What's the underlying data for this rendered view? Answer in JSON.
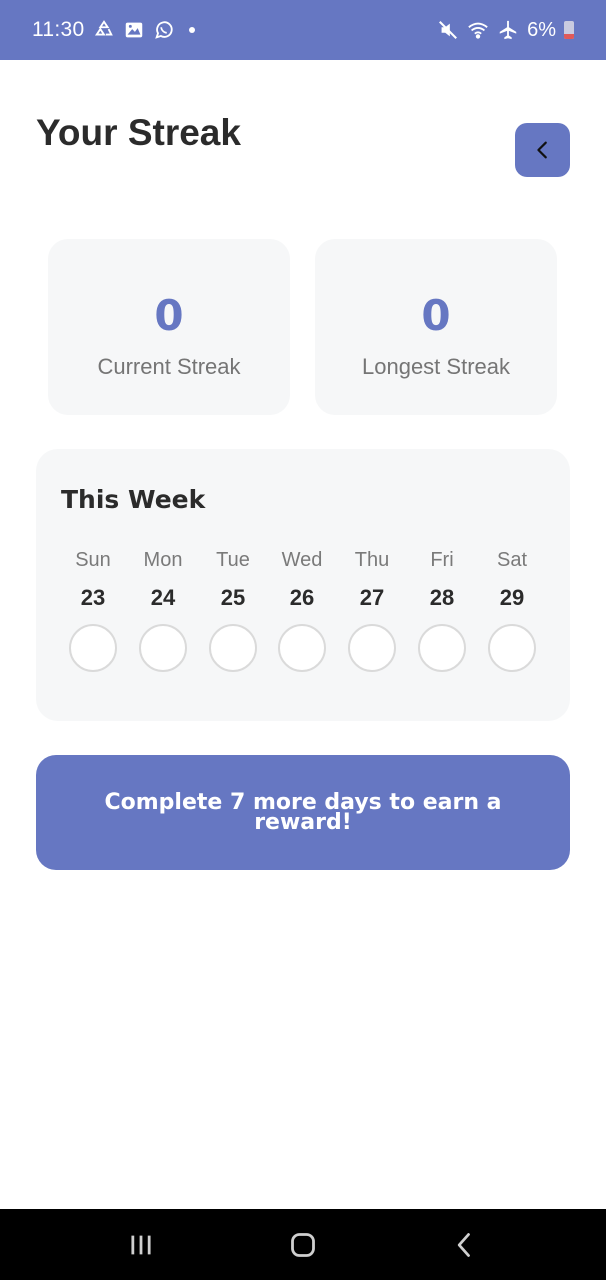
{
  "status_bar": {
    "time": "11:30",
    "battery_text": "6%",
    "battery_level": 0.06,
    "left_icons": [
      "recycle-icon",
      "gallery-icon",
      "whatsapp-icon"
    ],
    "right_icons": [
      "mute-icon",
      "wifi-icon",
      "airplane-icon",
      "battery-icon"
    ]
  },
  "header": {
    "title": "Your Streak",
    "back_icon": "chevron-left-icon"
  },
  "stats": {
    "current": {
      "value": "0",
      "label": "Current Streak"
    },
    "longest": {
      "value": "0",
      "label": "Longest Streak"
    }
  },
  "week": {
    "title": "This Week",
    "days": [
      {
        "name": "Sun",
        "date": "23",
        "completed": false
      },
      {
        "name": "Mon",
        "date": "24",
        "completed": false
      },
      {
        "name": "Tue",
        "date": "25",
        "completed": false
      },
      {
        "name": "Wed",
        "date": "26",
        "completed": false
      },
      {
        "name": "Thu",
        "date": "27",
        "completed": false
      },
      {
        "name": "Fri",
        "date": "28",
        "completed": false
      },
      {
        "name": "Sat",
        "date": "29",
        "completed": false
      }
    ]
  },
  "reward": {
    "text": "Complete 7 more days to earn a reward!"
  },
  "colors": {
    "accent": "#6677c2",
    "card_bg": "#f6f7f8",
    "title_text": "#2b2b2b",
    "muted_text": "#757575",
    "battery_low": "#e05a5a"
  },
  "nav_bar": {
    "buttons": [
      "recents-icon",
      "home-icon",
      "back-icon"
    ]
  }
}
